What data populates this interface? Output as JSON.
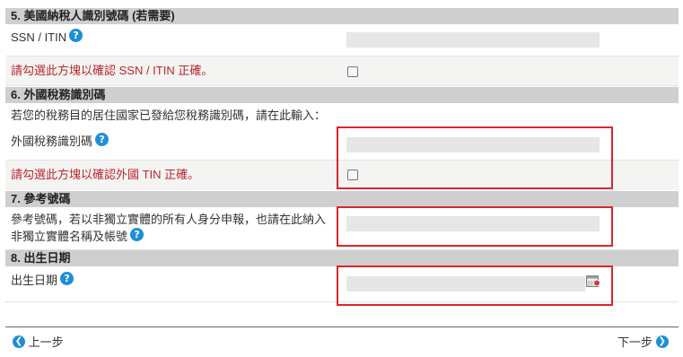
{
  "sections": [
    {
      "title": "5. 美國納稅人識別號碼 (若需要)"
    },
    {
      "title": "6. 外國稅務識別碼"
    },
    {
      "title": "7. 參考號碼"
    },
    {
      "title": "8. 出生日期"
    }
  ],
  "s5": {
    "ssn_label": "SSN / ITIN",
    "ssn_value": "",
    "confirm_label": "請勾選此方塊以確認 SSN / ITIN 正確。"
  },
  "s6": {
    "intro": "若您的稅務目的居住國家已發給您稅務識別碼，請在此輸入：",
    "tin_label": "外國稅務識別碼",
    "tin_value": "",
    "confirm_label": "請勾選此方塊以確認外國 TIN 正確。"
  },
  "s7": {
    "ref_label_line1": "參考號碼，若以非獨立實體的所有人身分申報，也請在此納入",
    "ref_label_line2": "非獨立實體名稱及帳號",
    "ref_value": ""
  },
  "s8": {
    "dob_label": "出生日期",
    "dob_value": ""
  },
  "nav": {
    "prev": "上一步",
    "next": "下一步"
  },
  "icons": {
    "help": "question-mark-icon",
    "prev": "chevron-left-circle-icon",
    "next": "chevron-right-circle-icon",
    "calendar": "calendar-icon"
  },
  "colors": {
    "header_bg": "#cfcfcf",
    "red_text": "#b8272d",
    "highlight_border": "#d9262c",
    "accent_blue": "#1d8fd8"
  }
}
